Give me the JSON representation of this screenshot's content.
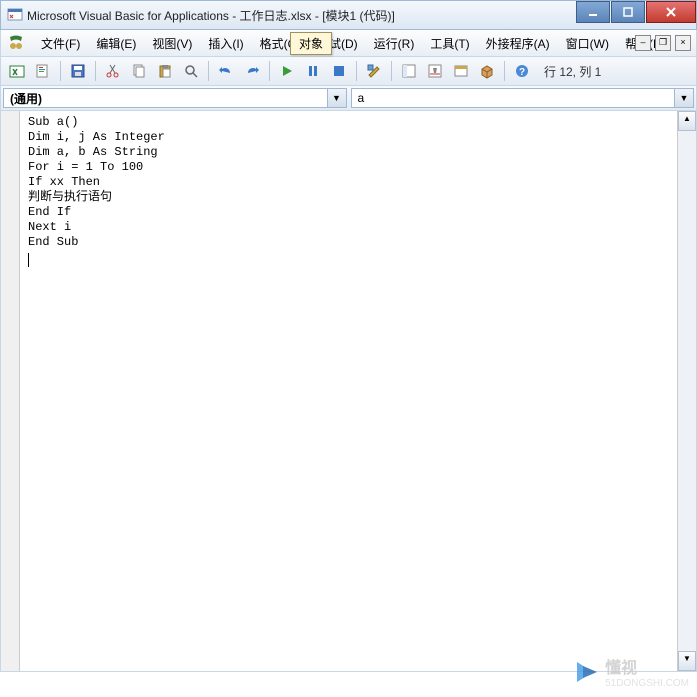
{
  "window": {
    "title": "Microsoft Visual Basic for Applications - 工作日志.xlsx - [模块1 (代码)]"
  },
  "menu": {
    "file": "文件(F)",
    "edit": "编辑(E)",
    "view": "视图(V)",
    "insert": "插入(I)",
    "format": "格式(O)",
    "debug": "调试(D)",
    "run": "运行(R)",
    "tools": "工具(T)",
    "addins": "外接程序(A)",
    "window": "窗口(W)",
    "help": "帮助(H)"
  },
  "toolbar": {
    "status": "行 12, 列 1"
  },
  "combos": {
    "left": "(通用)",
    "right": "a"
  },
  "tooltip": "对象",
  "code": {
    "lines": [
      "Sub a()",
      "Dim i, j As Integer",
      "Dim a, b As String",
      "For i = 1 To 100",
      "If xx Then",
      "判断与执行语句",
      "End If",
      "Next i",
      "End Sub"
    ]
  },
  "watermark": {
    "brand": "懂视",
    "domain": "51DONGSHI.COM"
  }
}
